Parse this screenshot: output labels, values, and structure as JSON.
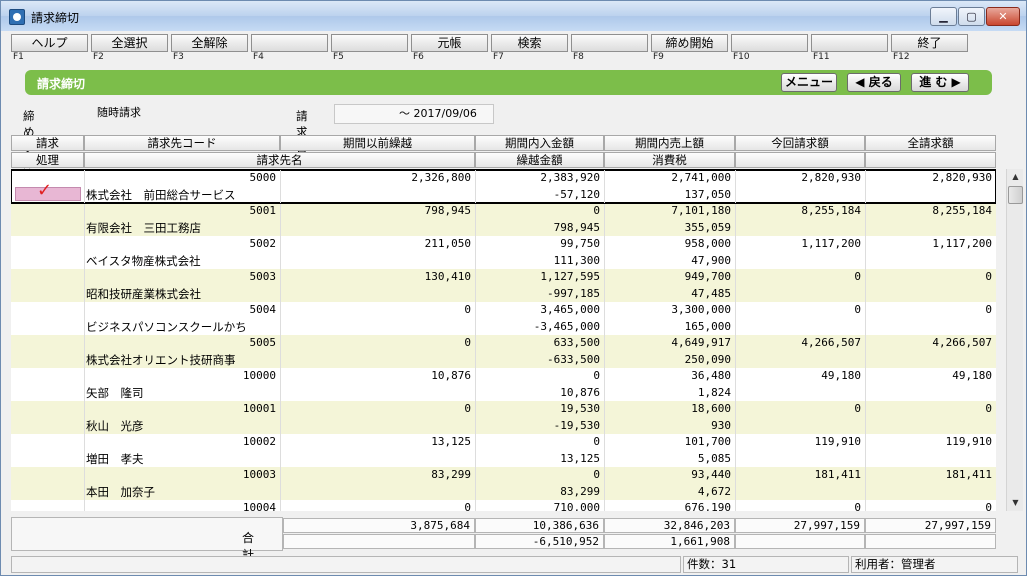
{
  "window": {
    "title": "請求締切"
  },
  "fkeys": [
    {
      "label": "ヘルプ",
      "key": "F1"
    },
    {
      "label": "全選択",
      "key": "F2"
    },
    {
      "label": "全解除",
      "key": "F3"
    },
    {
      "label": "",
      "key": "F4"
    },
    {
      "label": "",
      "key": "F5"
    },
    {
      "label": "元帳",
      "key": "F6"
    },
    {
      "label": "検索",
      "key": "F7"
    },
    {
      "label": "",
      "key": "F8"
    },
    {
      "label": "締め開始",
      "key": "F9"
    },
    {
      "label": "",
      "key": "F10"
    },
    {
      "label": "",
      "key": "F11"
    },
    {
      "label": "終了",
      "key": "F12"
    }
  ],
  "section": {
    "title": "請求締切",
    "menu": "メニュー",
    "back": "◀ 戻る",
    "next": "進 む ▶"
  },
  "filter": {
    "group_label": "締めグループ",
    "group_value": "随時請求",
    "date_label": "請求日",
    "date_value": "～ 2017/09/06"
  },
  "headers": {
    "row1": [
      "請求",
      "請求先コード",
      "期間以前繰越",
      "期間内入金額",
      "期間内売上額",
      "今回請求額",
      "全請求額"
    ],
    "row2": [
      "処理",
      "請求先名",
      "",
      "繰越金額",
      "消費税",
      "",
      ""
    ]
  },
  "rows": [
    {
      "code": "5000",
      "name": "株式会社　前田総合サービス",
      "prev": "2,326,800",
      "paid": "2,383,920",
      "carry": "-57,120",
      "sales": "2,741,000",
      "tax": "137,050",
      "bill": "2,820,930",
      "total": "2,820,930",
      "selected": true
    },
    {
      "code": "5001",
      "name": "有限会社　三田工務店",
      "prev": "798,945",
      "paid": "0",
      "carry": "798,945",
      "sales": "7,101,180",
      "tax": "355,059",
      "bill": "8,255,184",
      "total": "8,255,184"
    },
    {
      "code": "5002",
      "name": "ベイスタ物産株式会社",
      "prev": "211,050",
      "paid": "99,750",
      "carry": "111,300",
      "sales": "958,000",
      "tax": "47,900",
      "bill": "1,117,200",
      "total": "1,117,200"
    },
    {
      "code": "5003",
      "name": "昭和技研産業株式会社",
      "prev": "130,410",
      "paid": "1,127,595",
      "carry": "-997,185",
      "sales": "949,700",
      "tax": "47,485",
      "bill": "0",
      "total": "0"
    },
    {
      "code": "5004",
      "name": "ビジネスパソコンスクールかち",
      "prev": "0",
      "paid": "3,465,000",
      "carry": "-3,465,000",
      "sales": "3,300,000",
      "tax": "165,000",
      "bill": "0",
      "total": "0"
    },
    {
      "code": "5005",
      "name": "株式会社オリエント技研商事",
      "prev": "0",
      "paid": "633,500",
      "carry": "-633,500",
      "sales": "4,649,917",
      "tax": "250,090",
      "bill": "4,266,507",
      "total": "4,266,507"
    },
    {
      "code": "10000",
      "name": "矢部　隆司",
      "prev": "10,876",
      "paid": "0",
      "carry": "10,876",
      "sales": "36,480",
      "tax": "1,824",
      "bill": "49,180",
      "total": "49,180"
    },
    {
      "code": "10001",
      "name": "秋山　光彦",
      "prev": "0",
      "paid": "19,530",
      "carry": "-19,530",
      "sales": "18,600",
      "tax": "930",
      "bill": "0",
      "total": "0"
    },
    {
      "code": "10002",
      "name": "増田　孝夫",
      "prev": "13,125",
      "paid": "0",
      "carry": "13,125",
      "sales": "101,700",
      "tax": "5,085",
      "bill": "119,910",
      "total": "119,910"
    },
    {
      "code": "10003",
      "name": "本田　加奈子",
      "prev": "83,299",
      "paid": "0",
      "carry": "83,299",
      "sales": "93,440",
      "tax": "4,672",
      "bill": "181,411",
      "total": "181,411"
    },
    {
      "code": "10004",
      "name": "",
      "prev": "0",
      "paid": "710,000",
      "carry": "",
      "sales": "676,190",
      "tax": "",
      "bill": "0",
      "total": "0"
    }
  ],
  "totals": {
    "label": "合 計",
    "prev": "3,875,684",
    "paid": "10,386,636",
    "carry": "-6,510,952",
    "sales": "32,846,203",
    "tax": "1,661,908",
    "bill": "27,997,159",
    "total": "27,997,159"
  },
  "status": {
    "count": "件数：31",
    "user": "利用者：管理者"
  }
}
